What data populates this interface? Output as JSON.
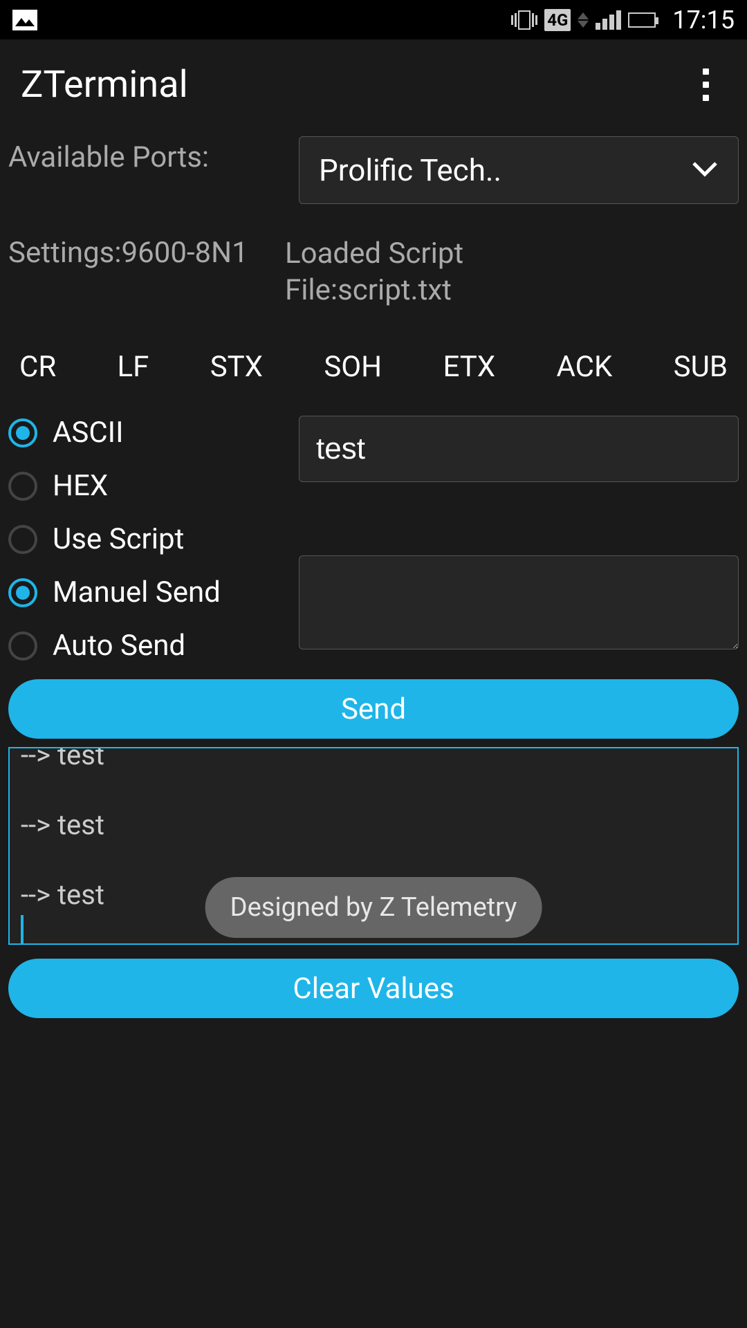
{
  "status": {
    "time": "17:15",
    "network": "4G"
  },
  "app": {
    "title": "ZTerminal"
  },
  "ports": {
    "label": "Available Ports:",
    "selected": "Prolific Tech.."
  },
  "settings": {
    "text": "Settings:9600-8N1"
  },
  "script": {
    "line1": "Loaded Script",
    "line2": "File:script.txt"
  },
  "control_chars": [
    "CR",
    "LF",
    "STX",
    "SOH",
    "ETX",
    "ACK",
    "SUB"
  ],
  "mode_radios": {
    "ascii": "ASCII",
    "hex": "HEX",
    "use_script": "Use Script"
  },
  "send_radios": {
    "manual": "Manuel Send",
    "auto": "Auto Send"
  },
  "input1": {
    "value": "test"
  },
  "input2": {
    "value": ""
  },
  "buttons": {
    "send": "Send",
    "clear": "Clear Values"
  },
  "terminal": {
    "lines": [
      "--> test",
      "--> test",
      "--> test"
    ]
  },
  "toast": {
    "text": "Designed by Z Telemetry"
  }
}
